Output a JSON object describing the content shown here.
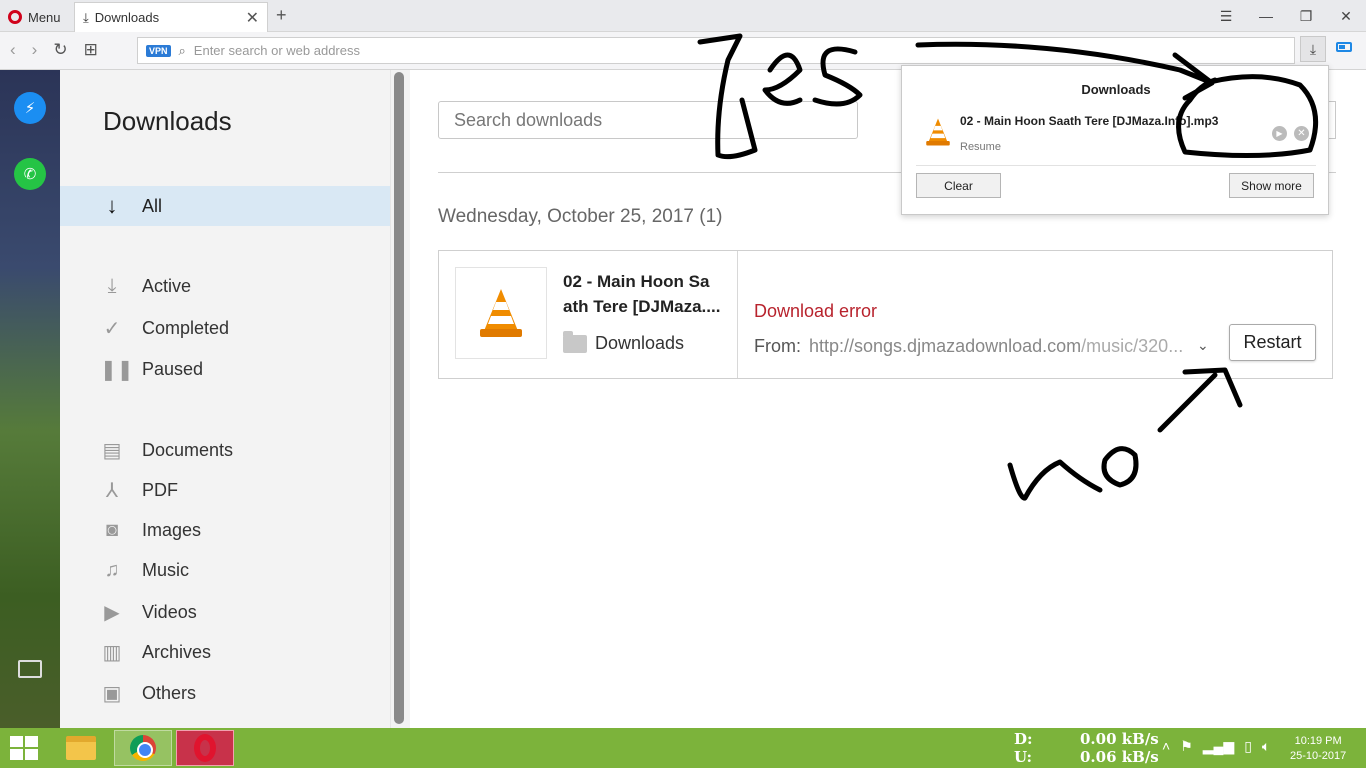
{
  "browser": {
    "menu_label": "Menu",
    "tab_title": "Downloads",
    "new_tab_symbol": "+",
    "address_placeholder": "Enter search or web address",
    "vpn_badge": "VPN"
  },
  "sidebar": {
    "title": "Downloads",
    "all_label": "All",
    "status_items": [
      {
        "label": "Active",
        "icon": "download-tray-icon"
      },
      {
        "label": "Completed",
        "icon": "check-icon"
      },
      {
        "label": "Paused",
        "icon": "pause-icon"
      }
    ],
    "type_items": [
      {
        "label": "Documents",
        "icon": "document-icon"
      },
      {
        "label": "PDF",
        "icon": "pdf-icon"
      },
      {
        "label": "Images",
        "icon": "camera-icon"
      },
      {
        "label": "Music",
        "icon": "music-note-icon"
      },
      {
        "label": "Videos",
        "icon": "video-icon"
      },
      {
        "label": "Archives",
        "icon": "zip-icon"
      },
      {
        "label": "Others",
        "icon": "terminal-icon"
      }
    ]
  },
  "main": {
    "search_placeholder": "Search downloads",
    "date_header": "Wednesday, October 25, 2017 (1)",
    "download": {
      "name_line1": "02 - Main Hoon Sa",
      "name_line2": "ath Tere [DJMaza....",
      "folder": "Downloads",
      "status": "Download error",
      "from_label": "From:",
      "url_main": "http://songs.djmazadownload.com",
      "url_rest": "/music/320...",
      "restart_label": "Restart"
    }
  },
  "popup": {
    "title": "Downloads",
    "file_name": "02 - Main Hoon Saath Tere [DJMaza.Info].mp3",
    "status": "Resume",
    "clear_label": "Clear",
    "show_more_label": "Show more"
  },
  "taskbar": {
    "net_down_label": "D:",
    "net_up_label": "U:",
    "net_down_value": "0.00 kB/s",
    "net_up_value": "0.06 kB/s",
    "time": "10:19 PM",
    "date": "25-10-2017"
  },
  "colors": {
    "error_red": "#b8232d",
    "selected_bg": "#d9e8f4",
    "taskbar_green": "#7cb33b",
    "opera_red": "#d0021b"
  }
}
